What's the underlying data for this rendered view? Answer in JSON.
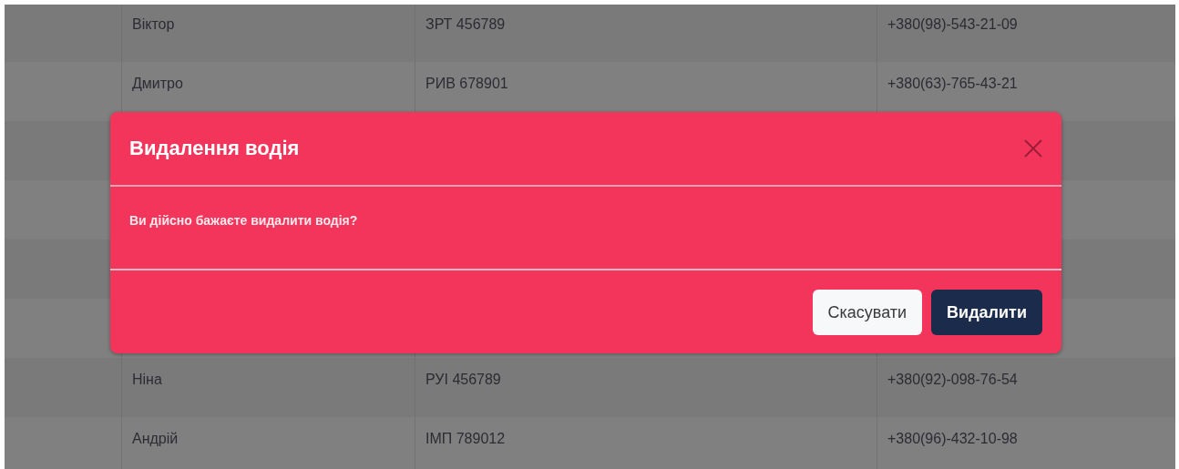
{
  "table": {
    "rows": [
      {
        "kind": "data",
        "cells": [
          "Віктор",
          "ЗРТ 456789",
          "+380(98)-543-21-09"
        ]
      },
      {
        "kind": "data",
        "cells": [
          "Дмитро",
          "РИВ 678901",
          "+380(63)-765-43-21"
        ]
      },
      {
        "kind": "covered"
      },
      {
        "kind": "covered"
      },
      {
        "kind": "covered"
      },
      {
        "kind": "covered"
      },
      {
        "kind": "data",
        "cells": [
          "Ніна",
          "РУІ 456789",
          "+380(92)-098-76-54"
        ]
      },
      {
        "kind": "data",
        "cells": [
          "Андрій",
          "ІМП 789012",
          "+380(96)-432-10-98"
        ]
      }
    ]
  },
  "dialog": {
    "title": "Видалення водія",
    "message": "Ви дійсно бажаєте видалити водія?",
    "buttons": [
      {
        "label": "Скасувати",
        "kind": "secondary"
      },
      {
        "label": "Видалити",
        "kind": "primary"
      }
    ]
  }
}
